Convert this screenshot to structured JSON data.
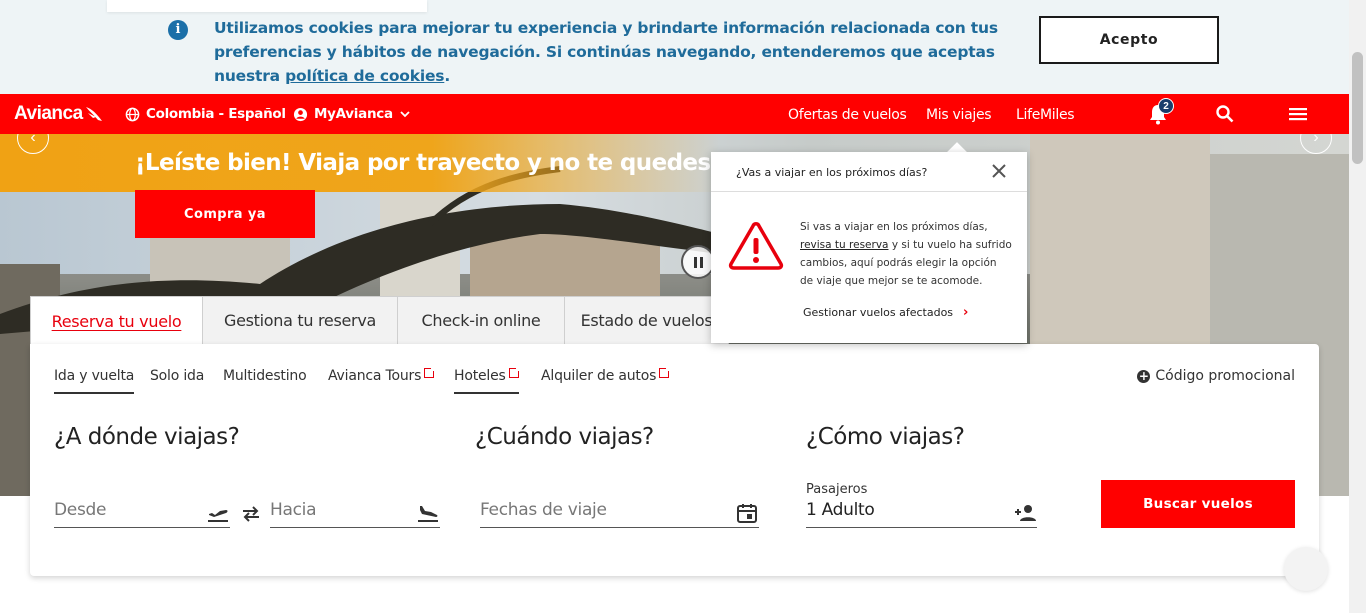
{
  "cookie_banner": {
    "text_before_link": "Utilizamos cookies para mejorar tu experiencia y brindarte información relacionada con tus preferencias y hábitos de navegación. Si continúas navegando, entenderemos que aceptas nuestra ",
    "link_text": "política de cookies",
    "text_after_link": ".",
    "accept_label": "Acepto",
    "icon": "info-icon"
  },
  "nav": {
    "logo": "Avianca",
    "locale_label": "Colombia - Español",
    "account_label": "MyAvianca",
    "links": [
      "Ofertas de vuelos",
      "Mis viajes",
      "LifeMiles"
    ],
    "notification_count": "2",
    "brand_color": "#ff0000"
  },
  "hero": {
    "headline": "¡Leíste bien! Viaja por trayecto y no te quedes pensándolo",
    "cta_label": "Compra ya",
    "banner_color": "#f0a214"
  },
  "booking": {
    "tabs": [
      "Reserva tu vuelo",
      "Gestiona tu reserva",
      "Check-in online",
      "Estado de vuelos"
    ],
    "active_tab": "Reserva tu vuelo",
    "subtabs": [
      "Ida y vuelta",
      "Solo ida",
      "Multidestino",
      "Avianca Tours",
      "Hoteles",
      "Alquiler de autos"
    ],
    "promo_label": "Código promocional",
    "where_title": "¿A dónde viajas?",
    "when_title": "¿Cuándo viajas?",
    "how_title": "¿Cómo viajas?",
    "from_placeholder": "Desde",
    "to_placeholder": "Hacia",
    "dates_placeholder": "Fechas de viaje",
    "passengers_label": "Pasajeros",
    "passengers_value": "1 Adulto",
    "search_label": "Buscar vuelos"
  },
  "popover": {
    "title": "¿Vas a viajar en los próximos días?",
    "body_before_link": "Si vas a viajar en los próximos días, ",
    "link_text": "revisa tu reserva",
    "body_after_link": " y si tu vuelo ha sufrido cambios, aquí podrás elegir la opción de viaje que mejor se te acomode.",
    "action_label": "Gestionar vuelos afectados",
    "icon": "warning-icon"
  }
}
